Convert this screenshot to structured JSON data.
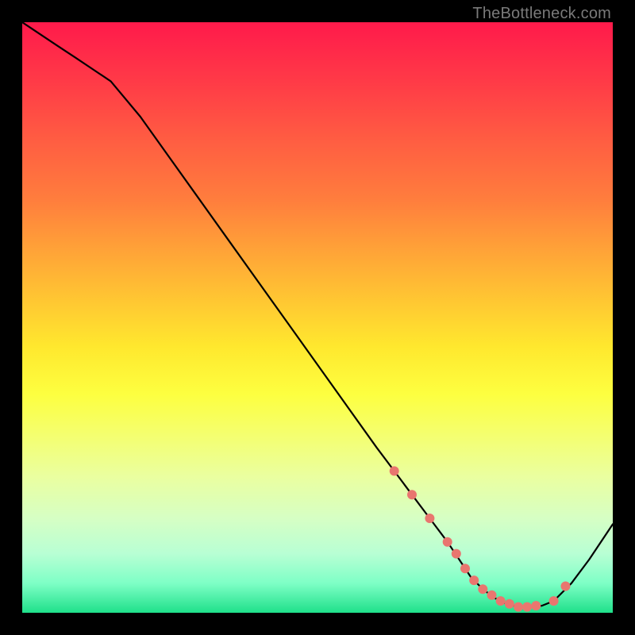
{
  "attribution": "TheBottleneck.com",
  "chart_data": {
    "type": "line",
    "title": "",
    "xlabel": "",
    "ylabel": "",
    "xlim": [
      0,
      100
    ],
    "ylim": [
      0,
      100
    ],
    "series": [
      {
        "name": "bottleneck-curve",
        "x": [
          0,
          3,
          6,
          9,
          12,
          15,
          20,
          25,
          30,
          35,
          40,
          45,
          50,
          55,
          60,
          63,
          66,
          69,
          72,
          74,
          76,
          78,
          80,
          82,
          84,
          86,
          88,
          90,
          93,
          96,
          100
        ],
        "y": [
          100,
          98,
          96,
          94,
          92,
          90,
          84,
          77,
          70,
          63,
          56,
          49,
          42,
          35,
          28,
          24,
          20,
          16,
          12,
          9,
          6,
          4,
          2.5,
          1.5,
          1,
          1,
          1.2,
          2,
          5,
          9,
          15
        ]
      }
    ],
    "markers": {
      "name": "highlight-dots",
      "color": "#e9766f",
      "x": [
        63,
        66,
        69,
        72,
        73.5,
        75,
        76.5,
        78,
        79.5,
        81,
        82.5,
        84,
        85.5,
        87,
        90,
        92
      ],
      "y": [
        24,
        20,
        16,
        12,
        10,
        7.5,
        5.5,
        4,
        3,
        2,
        1.5,
        1,
        1,
        1.2,
        2,
        4.5
      ]
    },
    "gradient_stops": [
      {
        "pos": 0,
        "color": "#ff1a4b"
      },
      {
        "pos": 50,
        "color": "#ffe82e"
      },
      {
        "pos": 100,
        "color": "#1fe08a"
      }
    ]
  }
}
